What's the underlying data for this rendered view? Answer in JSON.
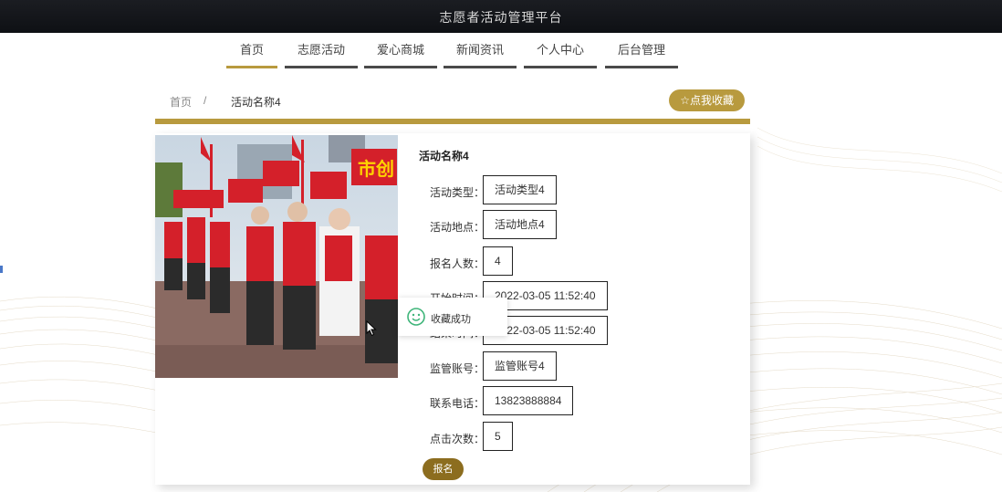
{
  "header": {
    "site_title": "志愿者活动管理平台"
  },
  "nav": {
    "items": [
      {
        "label": "首页",
        "active": true
      },
      {
        "label": "志愿活动",
        "active": false
      },
      {
        "label": "爱心商城",
        "active": false
      },
      {
        "label": "新闻资讯",
        "active": false
      },
      {
        "label": "个人中心",
        "active": false
      },
      {
        "label": "后台管理",
        "active": false
      }
    ]
  },
  "breadcrumb": {
    "home": "首页",
    "separator": "/",
    "current": "活动名称4"
  },
  "collect_button": {
    "icon": "star-outline-icon",
    "label": "点我收藏"
  },
  "activity": {
    "title": "活动名称4",
    "fields": [
      {
        "label": "活动类型：",
        "value": "活动类型4"
      },
      {
        "label": "活动地点：",
        "value": "活动地点4"
      },
      {
        "label": "报名人数：",
        "value": "4"
      },
      {
        "label": "开始时间：",
        "value": "2022-03-05 11:52:40"
      },
      {
        "label": "结束时间：",
        "value": "2022-03-05 11:52:40"
      },
      {
        "label": "监管账号：",
        "value": "监管账号4"
      },
      {
        "label": "联系电话：",
        "value": "13823888884"
      },
      {
        "label": "点击次数：",
        "value": "5"
      }
    ],
    "signup_label": "报名"
  },
  "toast": {
    "icon": "success-smile-icon",
    "text": "收藏成功"
  },
  "colors": {
    "accent": "#b89a3e",
    "signup": "#8c6d1f",
    "topbar": "#121418"
  }
}
